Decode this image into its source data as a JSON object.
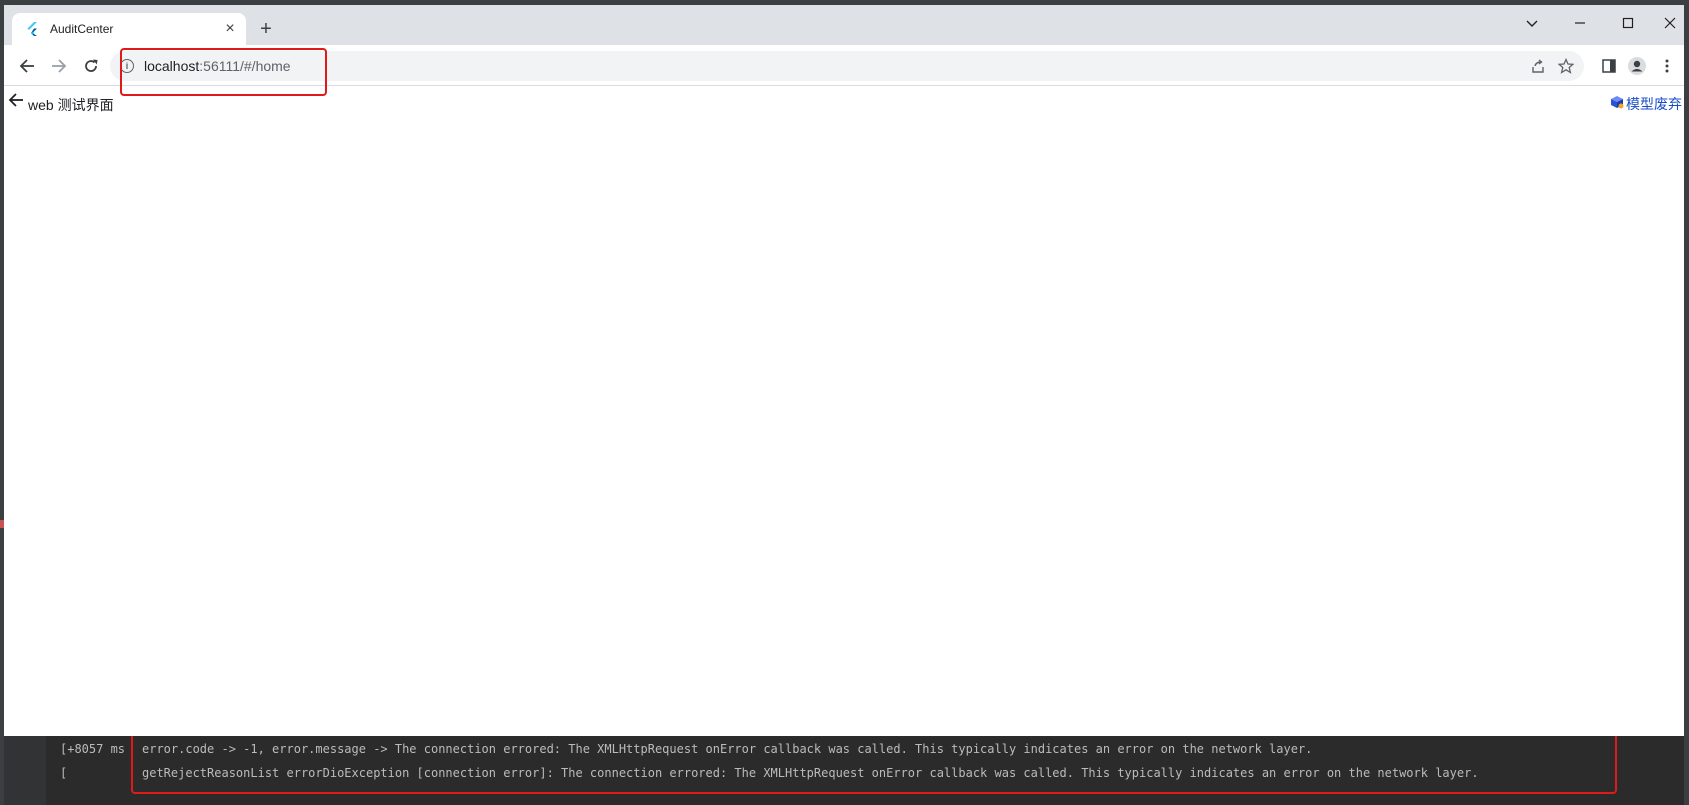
{
  "browser": {
    "tab": {
      "title": "AuditCenter",
      "close_label": "×"
    },
    "new_tab_label": "+",
    "window_controls": {
      "dropdown": "⌄",
      "minimize": "—",
      "maximize": "☐",
      "close": "✕"
    },
    "nav": {
      "back": "←",
      "forward": "→",
      "reload": "↻"
    },
    "omnibox": {
      "host": "localhost",
      "rest": ":56111/#/home",
      "info_icon": "i"
    },
    "icons": {
      "share": "share-icon",
      "bookmark": "star-icon",
      "sidepanel": "side-panel-icon",
      "profile": "profile-icon",
      "menu": "kebab-menu-icon"
    }
  },
  "page": {
    "back_label": "←",
    "title": "web 测试界面",
    "top_right_link": "模型废弃"
  },
  "console": {
    "line1_prefix": "[+8057 ms",
    "line1": "error.code -> -1, error.message -> The connection errored: The XMLHttpRequest onError callback was called. This typically indicates an error on the network layer.",
    "line2_prefix": "[",
    "line2": "getRejectReasonList errorDioException [connection error]: The connection errored: The XMLHttpRequest onError callback was called. This typically indicates an error on the network layer."
  },
  "colors": {
    "highlight": "#e0191b",
    "link": "#1a4fc9",
    "ide_bg": "#2b2b2b",
    "tabstrip": "#dee1e6"
  }
}
